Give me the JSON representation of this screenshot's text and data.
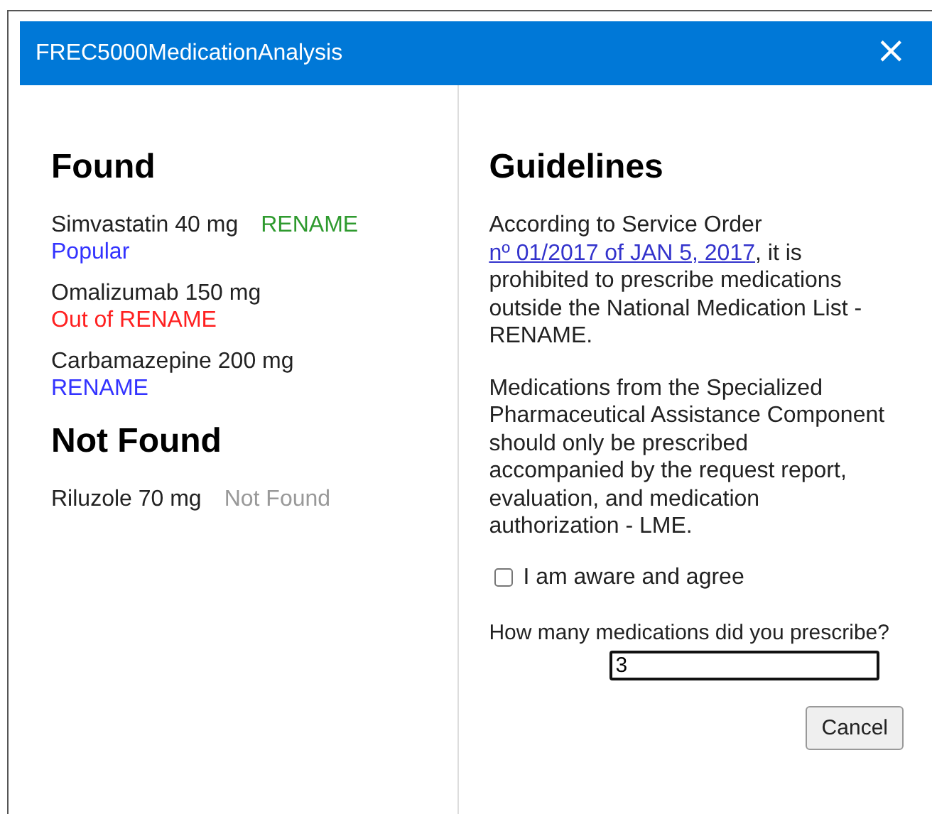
{
  "window": {
    "title": "FREC5000MedicationAnalysis",
    "close": "×"
  },
  "found": {
    "heading": "Found",
    "items": [
      {
        "name": "Simvastatin 40 mg",
        "labels": [
          {
            "text": "RENAME",
            "color": "#2e9a2e",
            "inline": true
          },
          {
            "text": "Popular",
            "color": "#3333ff",
            "inline": false
          }
        ]
      },
      {
        "name": "Omalizumab 150 mg",
        "labels": [
          {
            "text": "Out of RENAME",
            "color": "#ff2020",
            "inline": false
          }
        ]
      },
      {
        "name": "Carbamazepine 200 mg",
        "labels": [
          {
            "text": "RENAME",
            "color": "#3333ff",
            "inline": false
          }
        ]
      }
    ]
  },
  "not_found": {
    "heading": "Not Found",
    "items": [
      {
        "name": "Riluzole 70 mg",
        "labels": [
          {
            "text": "Not Found",
            "color": "#999999",
            "inline": true
          }
        ]
      }
    ]
  },
  "guidelines": {
    "heading": "Guidelines",
    "paragraph_1": {
      "before": "According to Service Order ",
      "link": "nº 01/2017 of JAN 5, 2017",
      "after": ", it is prohibited to prescribe medications outside the National Medication List - RENAME."
    },
    "paragraph_2": "Medications from the Specialized Pharmaceutical Assistance Component should only be prescribed accompanied by the request report, evaluation, and medication authorization - LME.",
    "agree": {
      "label": "I am aware and agree",
      "checked": false
    },
    "count": {
      "label": "How many medications did you prescribe?",
      "value": "3"
    },
    "buttons": [
      "Cancel"
    ]
  }
}
